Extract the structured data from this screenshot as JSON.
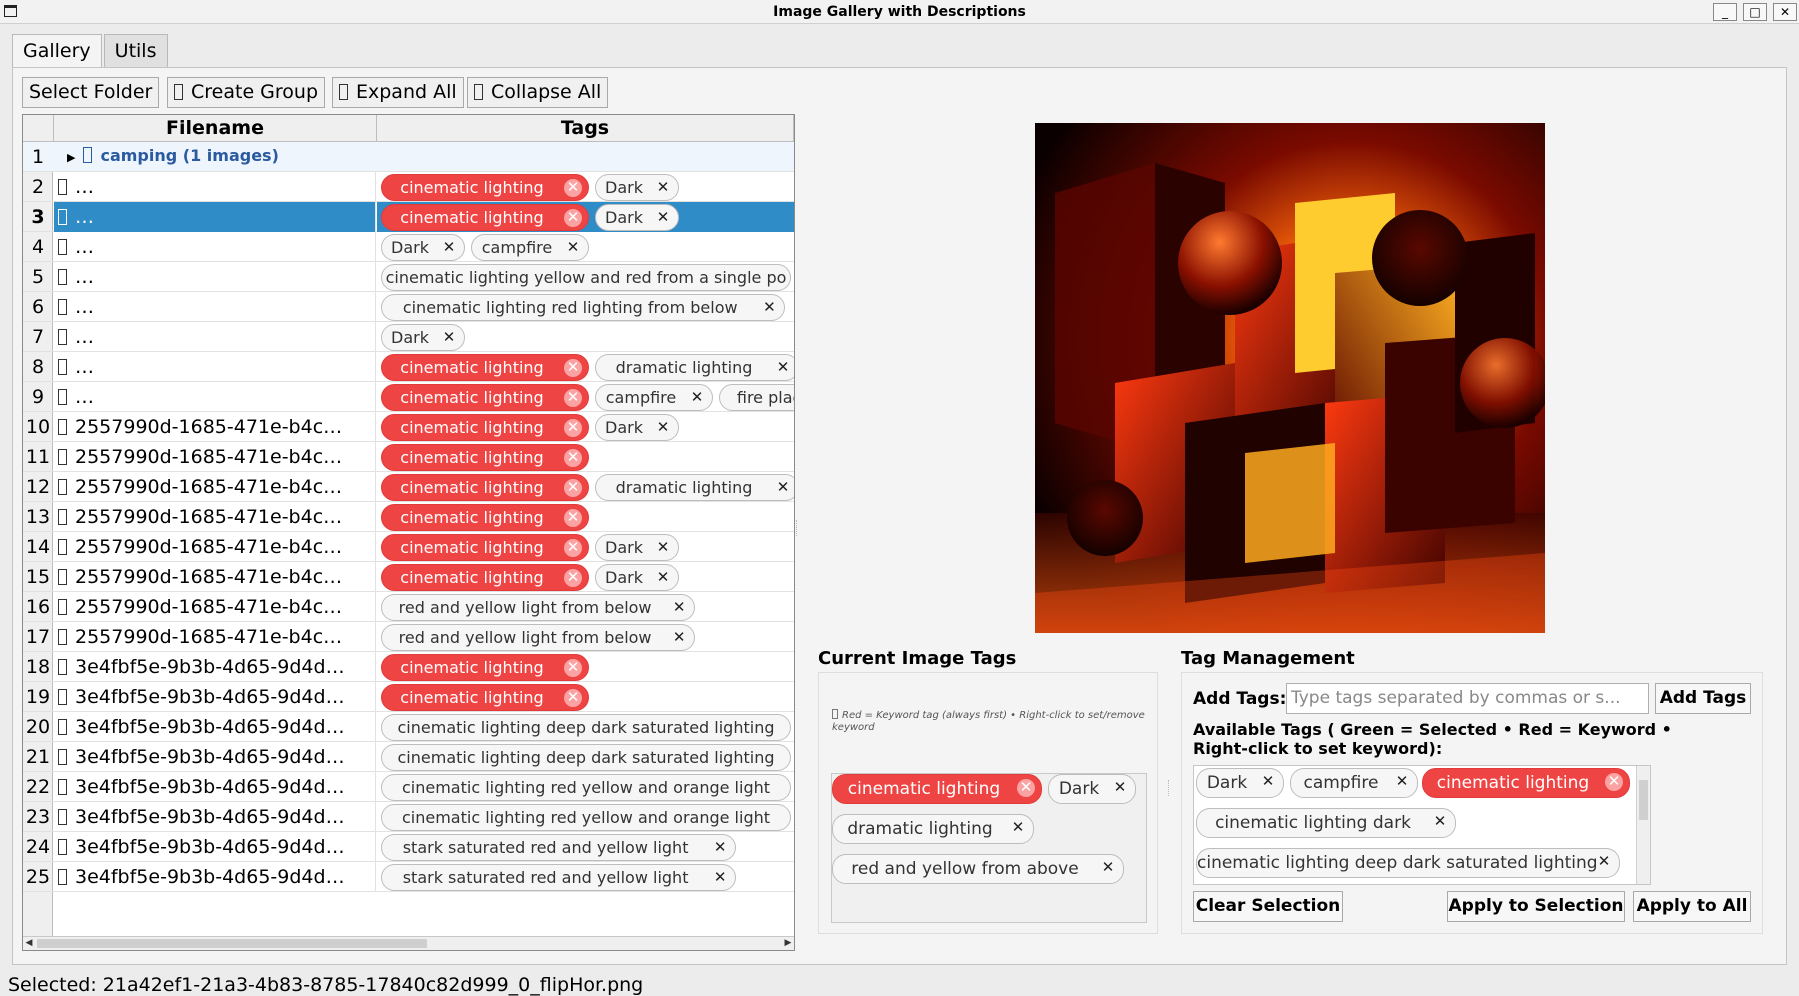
{
  "window": {
    "title": "Image Gallery with Descriptions",
    "minimize": "_",
    "maximize": "□",
    "close": "✕"
  },
  "tabs": [
    {
      "label": "Gallery",
      "active": true
    },
    {
      "label": "Utils",
      "active": false
    }
  ],
  "toolbar": {
    "select_folder": "Select Folder",
    "create_group": "Create Group",
    "expand_all": "Expand All",
    "collapse_all": "Collapse All"
  },
  "table": {
    "columns": [
      "Filename",
      "Tags"
    ],
    "group": {
      "row": "1",
      "arrow": "▶",
      "label": "camping (1 images)"
    },
    "rows": [
      {
        "n": "2",
        "file": "…",
        "tags": [
          {
            "t": "cinematic lighting",
            "kw": true
          },
          {
            "t": "Dark"
          }
        ]
      },
      {
        "n": "3",
        "file": "…",
        "selected": true,
        "tags": [
          {
            "t": "cinematic lighting",
            "kw": true
          },
          {
            "t": "Dark"
          }
        ]
      },
      {
        "n": "4",
        "file": "…",
        "tags": [
          {
            "t": "Dark"
          },
          {
            "t": "campfire"
          }
        ]
      },
      {
        "n": "5",
        "file": "…",
        "tags": [
          {
            "t": "cinematic lighting yellow and red from a single po",
            "long": true,
            "nox": true
          }
        ]
      },
      {
        "n": "6",
        "file": "…",
        "tags": [
          {
            "t": "cinematic lighting red lighting from below",
            "long": true
          }
        ]
      },
      {
        "n": "7",
        "file": "…",
        "tags": [
          {
            "t": "Dark"
          }
        ]
      },
      {
        "n": "8",
        "file": "…",
        "tags": [
          {
            "t": "cinematic lighting",
            "kw": true
          },
          {
            "t": "dramatic lighting"
          }
        ]
      },
      {
        "n": "9",
        "file": "…",
        "tags": [
          {
            "t": "cinematic lighting",
            "kw": true
          },
          {
            "t": "campfire"
          },
          {
            "t": "fire place",
            "nox": true
          }
        ]
      },
      {
        "n": "10",
        "file": "2557990d-1685-471e-b4c…",
        "tags": [
          {
            "t": "cinematic lighting",
            "kw": true
          },
          {
            "t": "Dark"
          }
        ]
      },
      {
        "n": "11",
        "file": "2557990d-1685-471e-b4c…",
        "tags": [
          {
            "t": "cinematic lighting",
            "kw": true
          }
        ]
      },
      {
        "n": "12",
        "file": "2557990d-1685-471e-b4c…",
        "tags": [
          {
            "t": "cinematic lighting",
            "kw": true
          },
          {
            "t": "dramatic lighting"
          }
        ]
      },
      {
        "n": "13",
        "file": "2557990d-1685-471e-b4c…",
        "tags": [
          {
            "t": "cinematic lighting",
            "kw": true
          }
        ]
      },
      {
        "n": "14",
        "file": "2557990d-1685-471e-b4c…",
        "tags": [
          {
            "t": "cinematic lighting",
            "kw": true
          },
          {
            "t": "Dark"
          }
        ]
      },
      {
        "n": "15",
        "file": "2557990d-1685-471e-b4c…",
        "tags": [
          {
            "t": "cinematic lighting",
            "kw": true
          },
          {
            "t": "Dark"
          }
        ]
      },
      {
        "n": "16",
        "file": "2557990d-1685-471e-b4c…",
        "tags": [
          {
            "t": "red and yellow light from below",
            "long": true
          }
        ]
      },
      {
        "n": "17",
        "file": "2557990d-1685-471e-b4c…",
        "tags": [
          {
            "t": "red and yellow light from below",
            "long": true
          }
        ]
      },
      {
        "n": "18",
        "file": "3e4fbf5e-9b3b-4d65-9d4d…",
        "tags": [
          {
            "t": "cinematic lighting",
            "kw": true
          }
        ]
      },
      {
        "n": "19",
        "file": "3e4fbf5e-9b3b-4d65-9d4d…",
        "tags": [
          {
            "t": "cinematic lighting",
            "kw": true
          }
        ]
      },
      {
        "n": "20",
        "file": "3e4fbf5e-9b3b-4d65-9d4d…",
        "tags": [
          {
            "t": "cinematic lighting deep dark saturated lighting",
            "long": true,
            "nox": true
          }
        ]
      },
      {
        "n": "21",
        "file": "3e4fbf5e-9b3b-4d65-9d4d…",
        "tags": [
          {
            "t": "cinematic lighting deep dark saturated lighting",
            "long": true,
            "nox": true
          }
        ]
      },
      {
        "n": "22",
        "file": "3e4fbf5e-9b3b-4d65-9d4d…",
        "tags": [
          {
            "t": "cinematic lighting red yellow and orange light",
            "long": true,
            "nox": true
          }
        ]
      },
      {
        "n": "23",
        "file": "3e4fbf5e-9b3b-4d65-9d4d…",
        "tags": [
          {
            "t": "cinematic lighting red yellow and orange light",
            "long": true,
            "nox": true
          }
        ]
      },
      {
        "n": "24",
        "file": "3e4fbf5e-9b3b-4d65-9d4d…",
        "tags": [
          {
            "t": "stark saturated red and yellow light",
            "long": true
          }
        ]
      },
      {
        "n": "25",
        "file": "3e4fbf5e-9b3b-4d65-9d4d…",
        "tags": [
          {
            "t": "stark saturated red and yellow light",
            "long": true
          }
        ]
      }
    ]
  },
  "current_tags": {
    "title": "Current Image Tags",
    "hint": "Red = Keyword tag (always first) • Right-click to set/remove keyword",
    "tags": [
      {
        "t": "cinematic lighting",
        "kw": true
      },
      {
        "t": "Dark"
      },
      {
        "t": "dramatic lighting"
      },
      {
        "t": "red and yellow from above"
      }
    ]
  },
  "tag_management": {
    "title": "Tag Management",
    "add_label": "Add Tags:",
    "add_placeholder": "Type tags separated by commas or s...",
    "add_button": "Add Tags",
    "available_label": "Available Tags ( Green = Selected •  Red = Keyword • Right-click to set keyword):",
    "available": [
      {
        "t": "Dark"
      },
      {
        "t": "campfire"
      },
      {
        "t": "cinematic lighting",
        "kw": true
      },
      {
        "t": "cinematic lighting dark"
      },
      {
        "t": "cinematic lighting deep dark saturated lighting"
      }
    ],
    "clear_selection": "Clear Selection",
    "apply_selection": "Apply to Selection",
    "apply_all": "Apply to All"
  },
  "status": "Selected: 21a42ef1-21a3-4b83-8785-17840c82d999_0_flipHor.png",
  "colors": {
    "keyword_red": "#ef4444",
    "selection_blue": "#308cc6",
    "group_text": "#2a5aa0"
  },
  "icons": {
    "group_arrow": "triangle-right-icon",
    "file_glyph": "file-icon",
    "remove_tag": "close-icon"
  }
}
